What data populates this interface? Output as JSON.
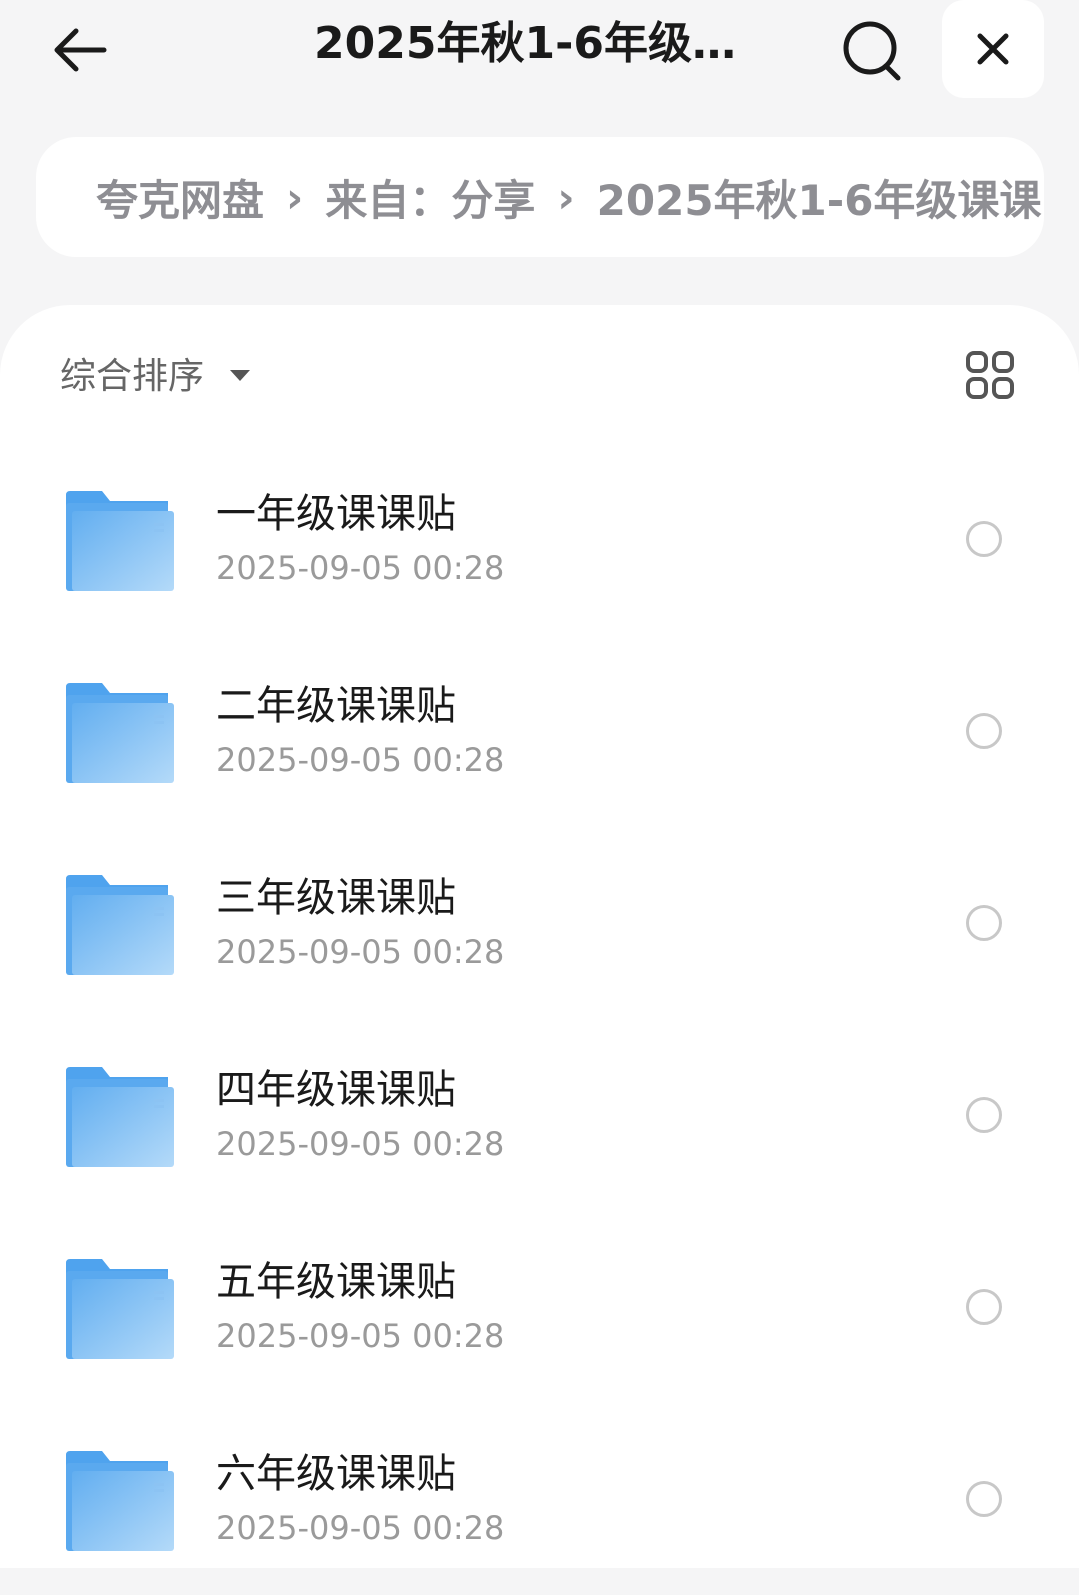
{
  "header": {
    "title": "2025年秋1-6年级…",
    "back_icon": "arrow-left-icon",
    "search_icon": "search-icon",
    "close_icon": "close-icon"
  },
  "breadcrumb": {
    "items": [
      "夸克网盘",
      "来自：分享",
      "2025年秋1-6年级课课"
    ],
    "separator": "›"
  },
  "toolbar": {
    "sort_label": "综合排序",
    "sort_icon": "caret-down-icon",
    "view_icon": "grid-view-icon"
  },
  "files": [
    {
      "name": "一年级课课贴",
      "date": "2025-09-05 00:28"
    },
    {
      "name": "二年级课课贴",
      "date": "2025-09-05 00:28"
    },
    {
      "name": "三年级课课贴",
      "date": "2025-09-05 00:28"
    },
    {
      "name": "四年级课课贴",
      "date": "2025-09-05 00:28"
    },
    {
      "name": "五年级课课贴",
      "date": "2025-09-05 00:28"
    },
    {
      "name": "六年级课课贴",
      "date": "2025-09-05 00:28"
    }
  ],
  "colors": {
    "folder": "#6fb4f0",
    "background": "#f5f5f6",
    "text_primary": "#1a1a1a",
    "text_secondary": "#9a9a9a"
  }
}
